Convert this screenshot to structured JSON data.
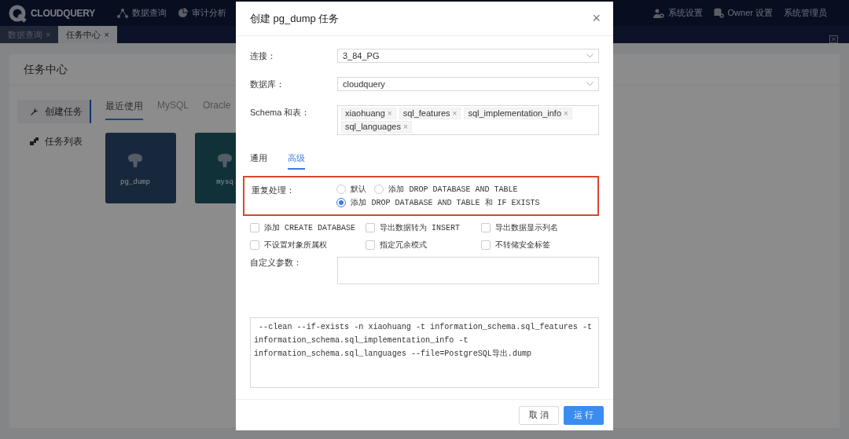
{
  "header": {
    "logo": "CLOUDQUERY",
    "nav": [
      {
        "label": "数据查询"
      },
      {
        "label": "审计分析"
      }
    ],
    "right": [
      {
        "label": "系统设置"
      },
      {
        "label": "Owner 设置"
      },
      {
        "label": "系统管理员"
      }
    ]
  },
  "page_tabs": [
    {
      "label": "数据查询",
      "close": "×",
      "selected": false
    },
    {
      "label": "任务中心",
      "close": "×",
      "selected": true
    }
  ],
  "page": {
    "title": "任务中心",
    "sidebar": [
      {
        "label": "创建任务",
        "selected": true
      },
      {
        "label": "任务列表",
        "selected": false
      }
    ],
    "tabs": [
      {
        "label": "最近使用",
        "selected": true
      },
      {
        "label": "MySQL",
        "selected": false
      },
      {
        "label": "Oracle",
        "selected": false
      }
    ],
    "tiles": [
      {
        "label": "pg_dump"
      },
      {
        "label": "mysq"
      }
    ]
  },
  "dialog": {
    "title": "创建 pg_dump 任务",
    "close": "×",
    "fields": [
      {
        "label": "连接：",
        "kind": "select",
        "value": "3_84_PG"
      },
      {
        "label": "数据库：",
        "kind": "select",
        "value": "cloudquery"
      },
      {
        "label": "Schema 和表：",
        "kind": "tags",
        "tags": [
          "xiaohuang",
          "sql_features",
          "sql_implementation_info",
          "sql_languages"
        ],
        "tag_close": "×"
      }
    ],
    "tabs": [
      {
        "label": "通用",
        "selected": false
      },
      {
        "label": "高级",
        "selected": true
      }
    ],
    "duplicate": {
      "label": "重复处理：",
      "options": [
        {
          "label": "默认",
          "selected": false
        },
        {
          "label": "添加 DROP DATABASE AND TABLE",
          "selected": false
        },
        {
          "label": "添加 DROP DATABASE AND TABLE 和 IF EXISTS",
          "selected": true
        }
      ]
    },
    "checkboxes": [
      {
        "label": "添加 CREATE DATABASE",
        "checked": false
      },
      {
        "label": "导出数据转为 INSERT",
        "checked": false
      },
      {
        "label": "导出数据显示列名",
        "checked": false
      },
      {
        "label": "不设置对象所属权",
        "checked": false
      },
      {
        "label": "指定冗余模式",
        "checked": false
      },
      {
        "label": "不转储安全标签",
        "checked": false
      }
    ],
    "custom_params": {
      "label": "自定义参数："
    },
    "command": " --clean --if-exists -n xiaohuang -t information_schema.sql_features -t information_schema.sql_implementation_info -t information_schema.sql_languages --file=PostgreSQL导出.dump",
    "buttons": [
      {
        "label": "取 消",
        "kind": "default"
      },
      {
        "label": "运 行",
        "kind": "primary"
      }
    ]
  }
}
